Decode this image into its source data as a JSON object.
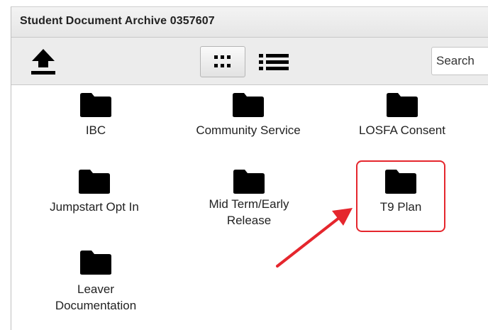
{
  "window": {
    "title": "Student Document Archive 0357607"
  },
  "toolbar": {
    "upload_icon": "upload-arrow-icon",
    "grid_view_icon": "grid-view-icon",
    "list_view_icon": "list-view-icon",
    "search_placeholder": "Search"
  },
  "folders": [
    {
      "label": "IBC",
      "icon": "folder-icon"
    },
    {
      "label": "Community Service",
      "icon": "folder-icon"
    },
    {
      "label": "LOSFA Consent",
      "icon": "folder-icon"
    },
    {
      "label": "Jumpstart Opt In",
      "icon": "folder-icon"
    },
    {
      "label": "Mid Term/Early Release",
      "icon": "folder-icon"
    },
    {
      "label": "T9 Plan",
      "icon": "folder-icon"
    },
    {
      "label": "Leaver Documentation",
      "icon": "folder-icon"
    }
  ],
  "annotation": {
    "highlight_color": "#e5262d",
    "arrow_color": "#e5262d",
    "target": "T9 Plan"
  }
}
